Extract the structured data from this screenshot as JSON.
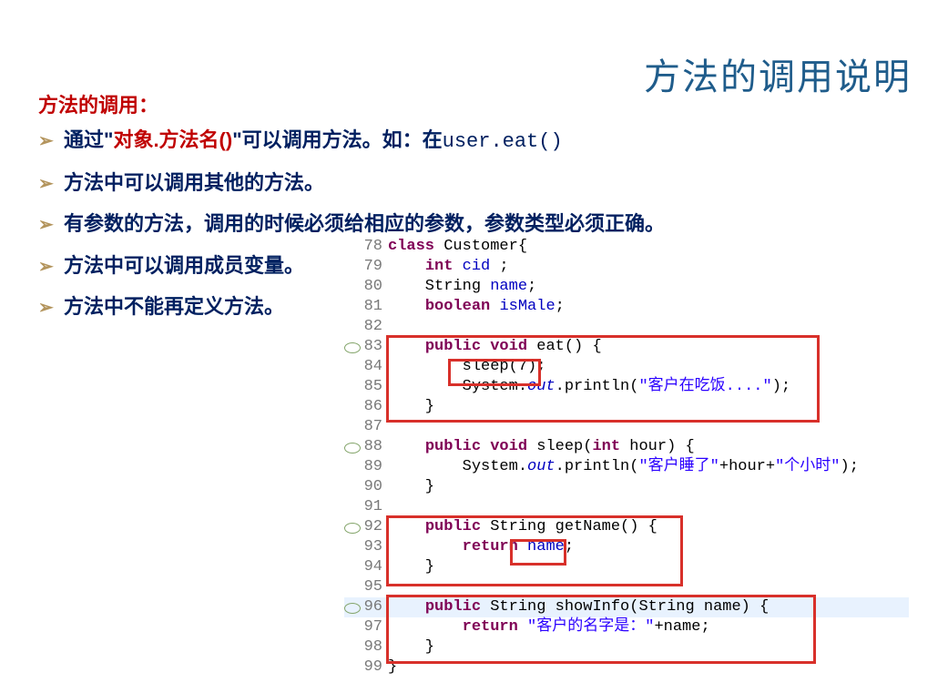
{
  "title": "方法的调用说明",
  "heading": "方法的调用：",
  "bullets": {
    "b1_a": "通过\"",
    "b1_b": "对象.方法名()",
    "b1_c": "\"可以调用方法。如：在",
    "b1_d": "user.eat()",
    "b2": "方法中可以调用其他的方法。",
    "b3": "有参数的方法，调用的时候必须给相应的参数，参数类型必须正确。",
    "b4": "方法中可以调用成员变量。",
    "b5": "方法中不能再定义方法。"
  },
  "code": {
    "lines": [
      {
        "n": "78",
        "hl": false,
        "ann": false,
        "tokens": [
          {
            "c": "kw",
            "t": "class"
          },
          {
            "c": "plain",
            "t": " Customer{"
          }
        ]
      },
      {
        "n": "79",
        "hl": false,
        "ann": false,
        "tokens": [
          {
            "c": "plain",
            "t": "    "
          },
          {
            "c": "kw",
            "t": "int"
          },
          {
            "c": "plain",
            "t": " "
          },
          {
            "c": "field",
            "t": "cid"
          },
          {
            "c": "plain",
            "t": " ;"
          }
        ]
      },
      {
        "n": "80",
        "hl": false,
        "ann": false,
        "tokens": [
          {
            "c": "plain",
            "t": "    String "
          },
          {
            "c": "field",
            "t": "name"
          },
          {
            "c": "plain",
            "t": ";"
          }
        ]
      },
      {
        "n": "81",
        "hl": false,
        "ann": false,
        "tokens": [
          {
            "c": "plain",
            "t": "    "
          },
          {
            "c": "kw",
            "t": "boolean"
          },
          {
            "c": "plain",
            "t": " "
          },
          {
            "c": "field",
            "t": "isMale"
          },
          {
            "c": "plain",
            "t": ";"
          }
        ]
      },
      {
        "n": "82",
        "hl": false,
        "ann": false,
        "tokens": [
          {
            "c": "plain",
            "t": ""
          }
        ]
      },
      {
        "n": "83",
        "hl": false,
        "ann": true,
        "tokens": [
          {
            "c": "plain",
            "t": "    "
          },
          {
            "c": "kw",
            "t": "public"
          },
          {
            "c": "plain",
            "t": " "
          },
          {
            "c": "kw",
            "t": "void"
          },
          {
            "c": "plain",
            "t": " eat() {"
          }
        ]
      },
      {
        "n": "84",
        "hl": false,
        "ann": false,
        "tokens": [
          {
            "c": "plain",
            "t": "        sleep(7);"
          }
        ]
      },
      {
        "n": "85",
        "hl": false,
        "ann": false,
        "tokens": [
          {
            "c": "plain",
            "t": "        System."
          },
          {
            "c": "static-f",
            "t": "out"
          },
          {
            "c": "plain",
            "t": ".println("
          },
          {
            "c": "str",
            "t": "\"客户在吃饭....\""
          },
          {
            "c": "plain",
            "t": ");"
          }
        ]
      },
      {
        "n": "86",
        "hl": false,
        "ann": false,
        "tokens": [
          {
            "c": "plain",
            "t": "    }"
          }
        ]
      },
      {
        "n": "87",
        "hl": false,
        "ann": false,
        "tokens": [
          {
            "c": "plain",
            "t": ""
          }
        ]
      },
      {
        "n": "88",
        "hl": false,
        "ann": true,
        "tokens": [
          {
            "c": "plain",
            "t": "    "
          },
          {
            "c": "kw",
            "t": "public"
          },
          {
            "c": "plain",
            "t": " "
          },
          {
            "c": "kw",
            "t": "void"
          },
          {
            "c": "plain",
            "t": " sleep("
          },
          {
            "c": "kw",
            "t": "int"
          },
          {
            "c": "plain",
            "t": " hour) {"
          }
        ]
      },
      {
        "n": "89",
        "hl": false,
        "ann": false,
        "tokens": [
          {
            "c": "plain",
            "t": "        System."
          },
          {
            "c": "static-f",
            "t": "out"
          },
          {
            "c": "plain",
            "t": ".println("
          },
          {
            "c": "str",
            "t": "\"客户睡了\""
          },
          {
            "c": "plain",
            "t": "+hour+"
          },
          {
            "c": "str",
            "t": "\"个小时\""
          },
          {
            "c": "plain",
            "t": ");"
          }
        ]
      },
      {
        "n": "90",
        "hl": false,
        "ann": false,
        "tokens": [
          {
            "c": "plain",
            "t": "    }"
          }
        ]
      },
      {
        "n": "91",
        "hl": false,
        "ann": false,
        "tokens": [
          {
            "c": "plain",
            "t": ""
          }
        ]
      },
      {
        "n": "92",
        "hl": false,
        "ann": true,
        "tokens": [
          {
            "c": "plain",
            "t": "    "
          },
          {
            "c": "kw",
            "t": "public"
          },
          {
            "c": "plain",
            "t": " String getName() {"
          }
        ]
      },
      {
        "n": "93",
        "hl": false,
        "ann": false,
        "tokens": [
          {
            "c": "plain",
            "t": "        "
          },
          {
            "c": "kw",
            "t": "return"
          },
          {
            "c": "plain",
            "t": " "
          },
          {
            "c": "field",
            "t": "name"
          },
          {
            "c": "plain",
            "t": ";"
          }
        ]
      },
      {
        "n": "94",
        "hl": false,
        "ann": false,
        "tokens": [
          {
            "c": "plain",
            "t": "    }"
          }
        ]
      },
      {
        "n": "95",
        "hl": false,
        "ann": false,
        "tokens": [
          {
            "c": "plain",
            "t": ""
          }
        ]
      },
      {
        "n": "96",
        "hl": true,
        "ann": true,
        "tokens": [
          {
            "c": "plain",
            "t": "    "
          },
          {
            "c": "kw",
            "t": "public"
          },
          {
            "c": "plain",
            "t": " String showInfo(String name) {"
          }
        ]
      },
      {
        "n": "97",
        "hl": false,
        "ann": false,
        "tokens": [
          {
            "c": "plain",
            "t": "        "
          },
          {
            "c": "kw",
            "t": "return"
          },
          {
            "c": "plain",
            "t": " "
          },
          {
            "c": "str",
            "t": "\"客户的名字是：\""
          },
          {
            "c": "plain",
            "t": "+name;"
          }
        ]
      },
      {
        "n": "98",
        "hl": false,
        "ann": false,
        "tokens": [
          {
            "c": "plain",
            "t": "    }"
          }
        ]
      },
      {
        "n": "99",
        "hl": false,
        "ann": false,
        "tokens": [
          {
            "c": "plain",
            "t": "}"
          }
        ]
      }
    ]
  }
}
